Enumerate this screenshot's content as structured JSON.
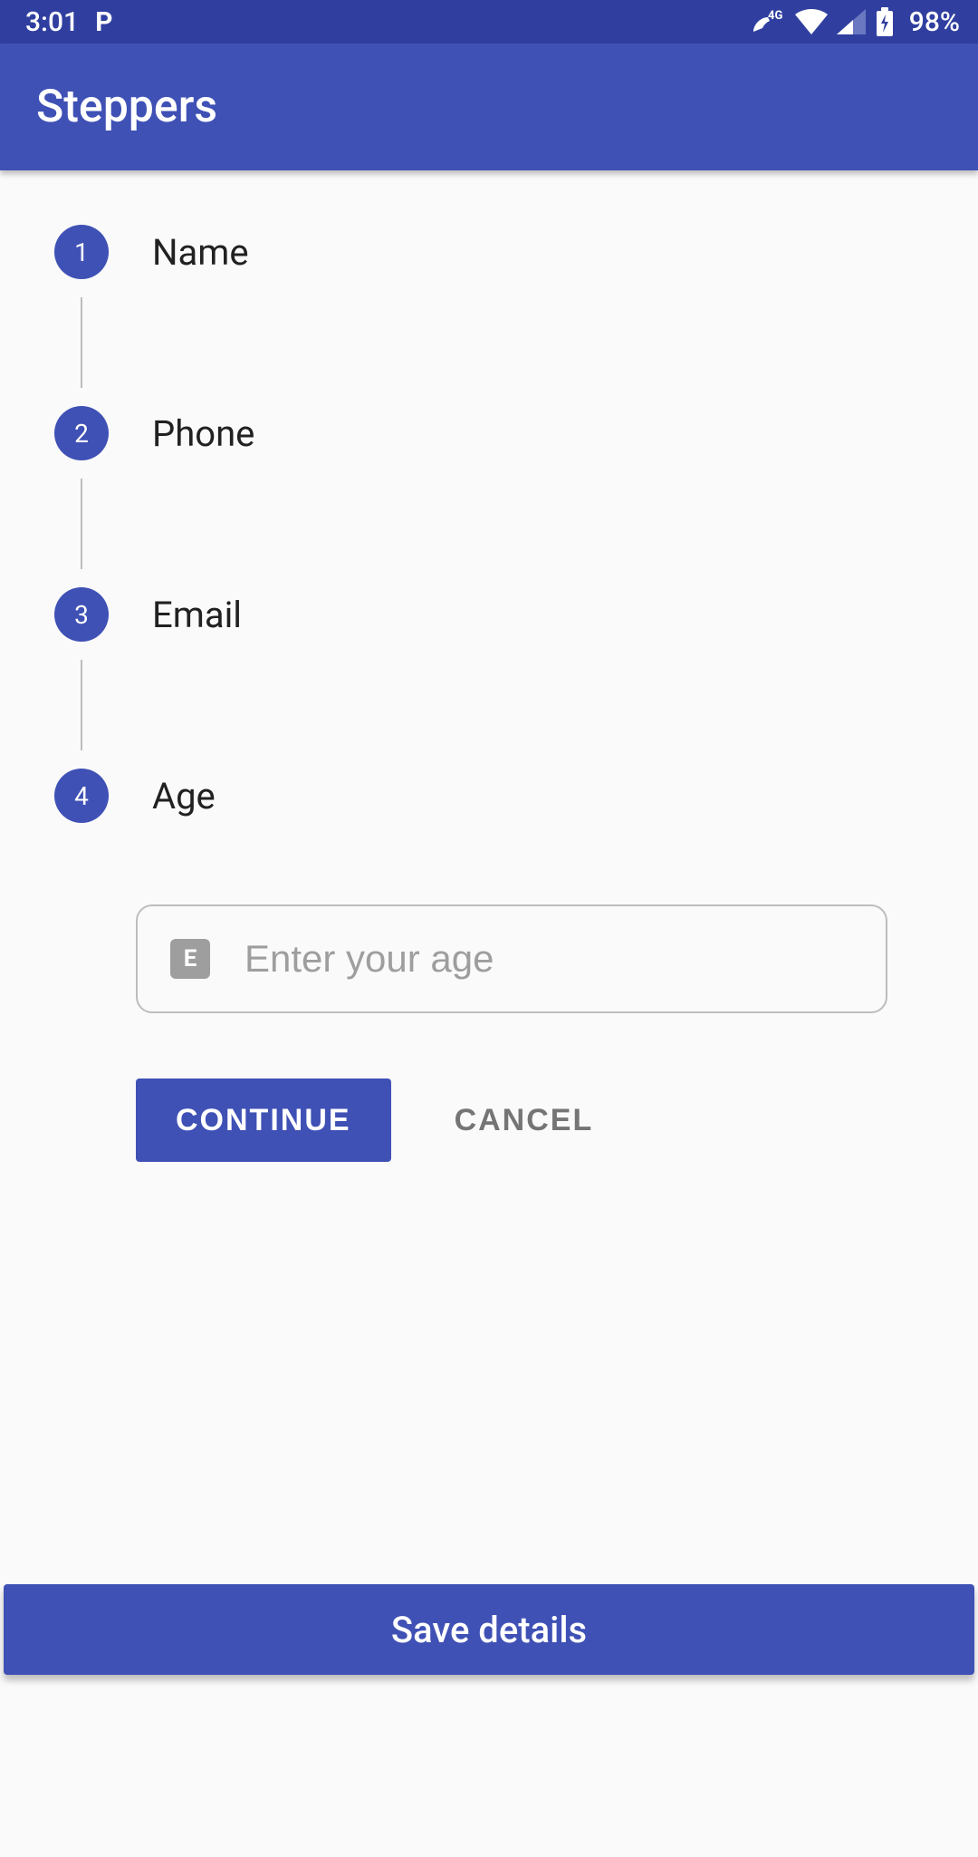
{
  "status": {
    "time": "3:01",
    "battery": "98%",
    "network_label": "4G"
  },
  "appbar": {
    "title": "Steppers"
  },
  "steps": [
    {
      "num": "1",
      "label": "Name"
    },
    {
      "num": "2",
      "label": "Phone"
    },
    {
      "num": "3",
      "label": "Email"
    },
    {
      "num": "4",
      "label": "Age"
    }
  ],
  "active_step_input": {
    "badge": "E",
    "placeholder": "Enter your age",
    "value": ""
  },
  "buttons": {
    "continue": "CONTINUE",
    "cancel": "CANCEL",
    "save": "Save details"
  }
}
